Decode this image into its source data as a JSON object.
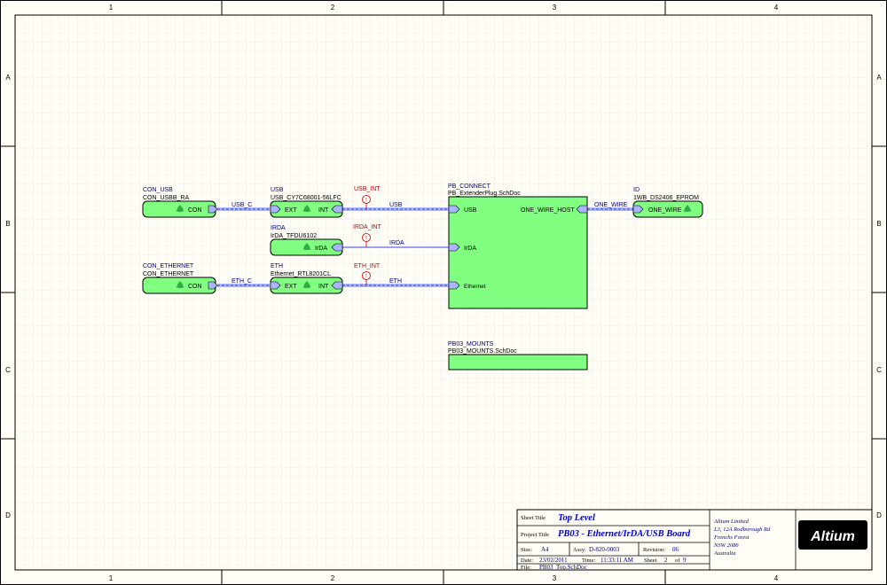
{
  "border": {
    "columns": [
      "1",
      "2",
      "3",
      "4"
    ],
    "rows": [
      "A",
      "B",
      "C",
      "D"
    ]
  },
  "colors": {
    "block_fill": "#80ff80",
    "designator": "#000080",
    "filename": "#000000",
    "harness_stroke": "#aab4ff",
    "net_label": "#000080",
    "power_flag": "#c00000",
    "title_blue": "#0000cc"
  },
  "sheet_symbols": [
    {
      "designator": "CON_USB",
      "filename": "CON_USBB_RA",
      "entries": [
        "CON"
      ],
      "icon": "recycle-icon"
    },
    {
      "designator": "USB",
      "filename": "USB_CY7C68001-56LFC",
      "entries": [
        "EXT",
        "INT"
      ],
      "icon": "recycle-icon"
    },
    {
      "designator": "IRDA",
      "filename": "IrDA_TFDU6102",
      "entries": [
        "IrDA"
      ],
      "icon": "recycle-icon"
    },
    {
      "designator": "CON_ETHERNET",
      "filename": "CON_ETHERNET",
      "entries": [
        "CON"
      ],
      "icon": "recycle-icon"
    },
    {
      "designator": "ETH",
      "filename": "Ethernet_RTL8201CL",
      "entries": [
        "EXT",
        "INT"
      ],
      "icon": "recycle-icon"
    },
    {
      "designator": "ID",
      "filename": "1WB_DS2406_EPROM",
      "entries": [
        "ONE_WIRE"
      ],
      "icon": "recycle-icon"
    },
    {
      "designator": "PB_CONNECT",
      "filename": "PB_ExtenderPlug.SchDoc",
      "entries": [
        "USB",
        "IrDA",
        "Ethernet",
        "ONE_WIRE_HOST"
      ]
    },
    {
      "designator": "PB03_MOUNTS",
      "filename": "PB03_MOUNTS.SchDoc",
      "entries": []
    }
  ],
  "net_labels": [
    "USB_C",
    "USB",
    "IRDA",
    "ETH_C",
    "ETH",
    "ONE_WIRE"
  ],
  "flags": [
    "USB_INT",
    "IRDA_INT",
    "ETH_INT"
  ],
  "title_block": {
    "sheet_title_label": "Sheet Title",
    "sheet_title": "Top Level",
    "project_title_label": "Project Title",
    "project_title": "PB03 - Ethernet/IrDA/USB Board",
    "size_label": "Size:",
    "size": "A4",
    "assy_label": "Assy:",
    "assy": "D-820-0003",
    "revision_label": "Revision:",
    "revision": "06",
    "date_label": "Date:",
    "date": "23/02/2011",
    "time_label": "Time:",
    "time": "11:33:11 AM",
    "sheet_label": "Sheet",
    "sheet_no": "2",
    "of_label": "of",
    "sheet_total": "9",
    "file_label": "File:",
    "file": "PB03_Top.SchDoc",
    "company": [
      "Altium Limited",
      "L3, 12A Rodborough Rd",
      "Frenchs Forest",
      "NSW 2086",
      "Australia"
    ],
    "logo": "Altium"
  }
}
